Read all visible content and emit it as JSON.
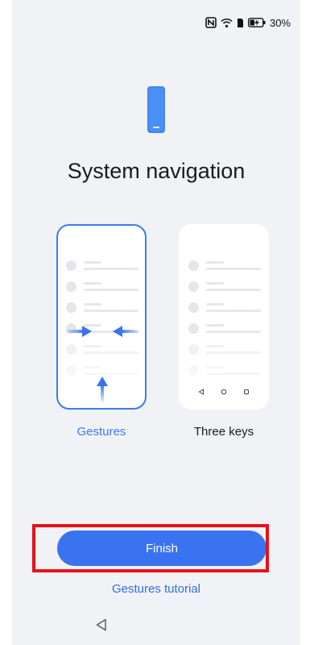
{
  "status_bar": {
    "battery_text": "30%",
    "icons": [
      "nfc-icon",
      "wifi-icon",
      "sim-icon",
      "battery-icon"
    ]
  },
  "title": "System navigation",
  "options": [
    {
      "label": "Gestures",
      "selected": true
    },
    {
      "label": "Three keys",
      "selected": false
    }
  ],
  "finish_label": "Finish",
  "tutorial_label": "Gestures tutorial",
  "colors": {
    "accent": "#3a73f0",
    "background": "#f1f2f6",
    "highlight_box": "#e8101a"
  },
  "nav": {
    "back_icon": "back-triangle-icon"
  }
}
